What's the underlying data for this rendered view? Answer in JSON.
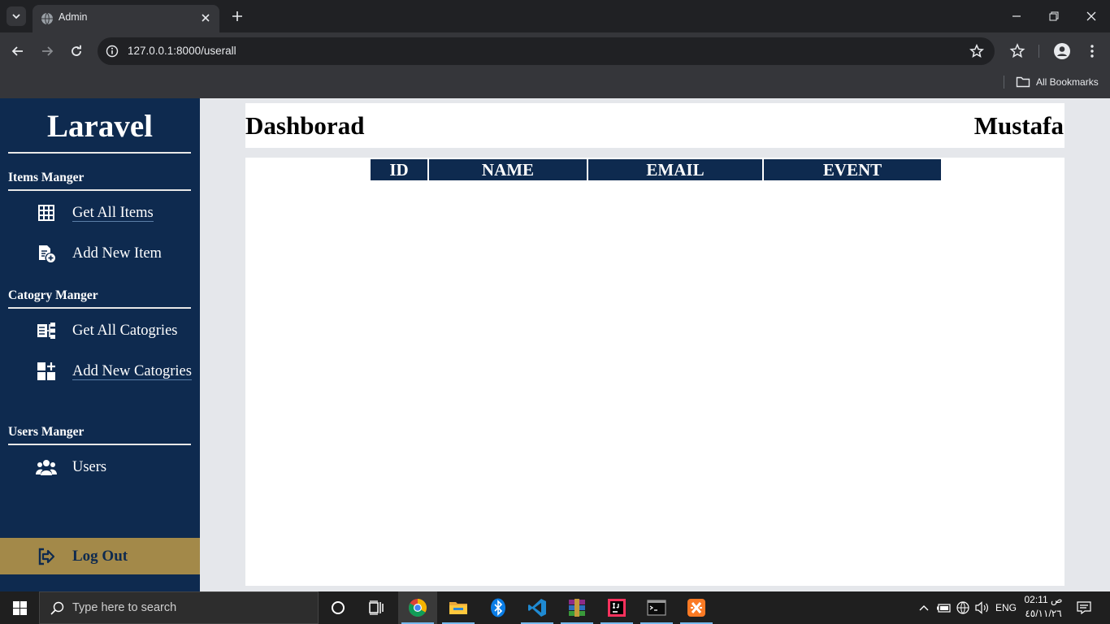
{
  "browser": {
    "tab_title": "Admin",
    "url": "127.0.0.1:8000/userall",
    "all_bookmarks_label": "All Bookmarks"
  },
  "sidebar": {
    "brand": "Laravel",
    "sections": [
      {
        "title": "Items Manger",
        "items": [
          {
            "label": "Get All Items",
            "icon": "grid-icon"
          },
          {
            "label": "Add New Item",
            "icon": "add-file-icon"
          }
        ]
      },
      {
        "title": "Catogry Manger",
        "items": [
          {
            "label": "Get All Catogries",
            "icon": "category-tree-icon"
          },
          {
            "label": "Add New Catogries",
            "icon": "add-grid-icon"
          }
        ]
      },
      {
        "title": "Users Manger",
        "items": [
          {
            "label": "Users",
            "icon": "users-icon"
          }
        ]
      }
    ],
    "logout_label": "Log Out"
  },
  "header": {
    "title": "Dashborad",
    "user_name": "Mustafa"
  },
  "table": {
    "columns": [
      "ID",
      "NAME",
      "EMAIL",
      "EVENT"
    ],
    "rows": []
  },
  "taskbar": {
    "search_placeholder": "Type here to search",
    "language": "ENG",
    "time": "02:11 ص",
    "date": "٤٥/١١/٢٦"
  },
  "colors": {
    "sidebar_bg": "#0e2a4f",
    "logout_bg": "#a38949",
    "page_bg": "#e5e7eb"
  }
}
